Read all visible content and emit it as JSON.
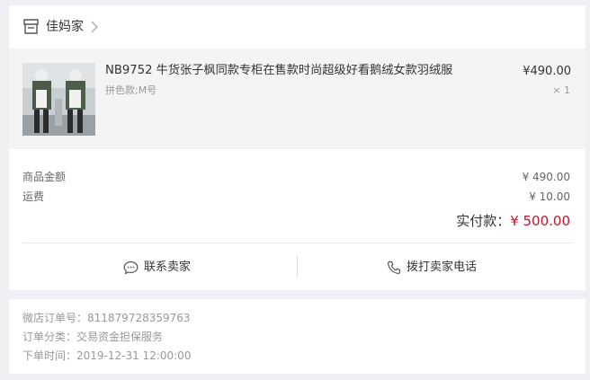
{
  "shop": {
    "name": "佳妈家"
  },
  "product": {
    "title": "NB9752 牛货张子枫同款专柜在售款时尚超级好看鹅绒女款羽绒服",
    "spec": "拼色款;M号",
    "price": "¥490.00",
    "quantity": "× 1"
  },
  "summary": {
    "goods_label": "商品金额",
    "goods_value": "¥ 490.00",
    "shipping_label": "运费",
    "shipping_value": "¥ 10.00",
    "total_label": "实付款：",
    "total_value": "¥ 500.00"
  },
  "actions": {
    "contact_label": "联系卖家",
    "call_label": "拨打卖家电话"
  },
  "meta": {
    "order_no": "微店订单号：811879728359763",
    "order_type": "订单分类：交易资金担保服务",
    "order_time": "下单时间：2019-12-31 12:00:00"
  },
  "colors": {
    "accent_price": "#c0182b",
    "page_bg": "#efeff4",
    "product_bg": "#f4f4f4"
  },
  "icons": {
    "shop": "store-icon",
    "chevron": "chevron-right-icon",
    "contact": "chat-bubble-icon",
    "call": "phone-icon"
  }
}
